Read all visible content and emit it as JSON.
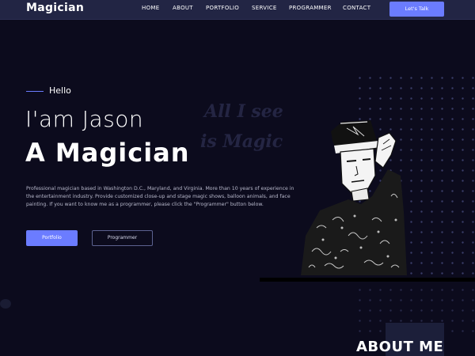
{
  "nav": {
    "logo": "Magician",
    "links": [
      "HOME",
      "ABOUT",
      "PORTFOLIO",
      "SERVICE",
      "PROGRAMMER",
      "CONTACT"
    ],
    "cta": "Let's Talk"
  },
  "hero": {
    "greeting": "Hello",
    "line1": "I'am Jason",
    "line2": "A Magician",
    "bio": "Professional magician based in Washington D.C., Maryland, and Virginia. More than 10 years of experience in the entertainment industry. Provide customized close-up and stage magic shows, balloon animals, and face painting. If you want to know me as a programmer, please click the \"Programmer\" button below.",
    "btn_portfolio": "Portfolio",
    "btn_programmer": "Programmer",
    "watermark_line1": "All I see",
    "watermark_line2": "is Magic"
  },
  "about": {
    "title": "ABOUT ME"
  },
  "colors": {
    "background": "#0c0b1d",
    "nav": "#222544",
    "accent": "#6b7cff",
    "text_muted": "#b8b9cc"
  }
}
